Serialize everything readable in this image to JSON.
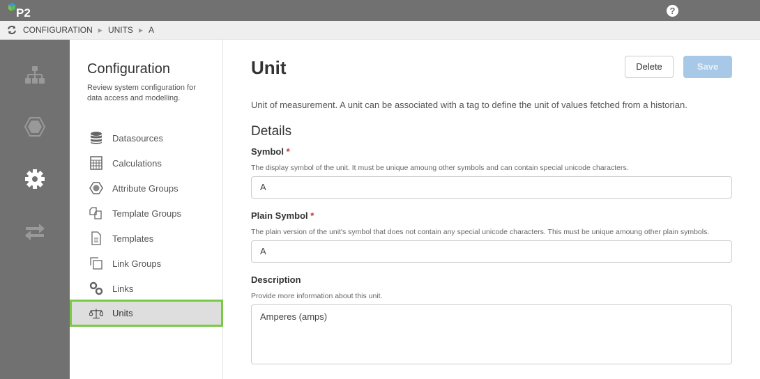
{
  "header": {
    "logo_text": "P2",
    "help_label": "?"
  },
  "breadcrumb": [
    "CONFIGURATION",
    "UNITS",
    "A"
  ],
  "rail": [
    {
      "icon": "sitemap-icon"
    },
    {
      "icon": "hexagon-icon"
    },
    {
      "icon": "gear-icon",
      "active": true
    },
    {
      "icon": "exchange-icon"
    }
  ],
  "nav": {
    "title": "Configuration",
    "subtitle": "Review system configuration for data access and modelling.",
    "items": [
      {
        "label": "Datasources"
      },
      {
        "label": "Calculations"
      },
      {
        "label": "Attribute Groups"
      },
      {
        "label": "Template Groups"
      },
      {
        "label": "Templates"
      },
      {
        "label": "Link Groups"
      },
      {
        "label": "Links"
      },
      {
        "label": "Units",
        "active": true
      }
    ]
  },
  "main": {
    "title": "Unit",
    "delete_label": "Delete",
    "save_label": "Save",
    "description": "Unit of measurement. A unit can be associated with a tag to define the unit of values fetched from a historian.",
    "details_heading": "Details",
    "symbol": {
      "label": "Symbol",
      "required": "*",
      "help": "The display symbol of the unit. It must be unique amoung other symbols and can contain special unicode characters.",
      "value": "A"
    },
    "plain_symbol": {
      "label": "Plain Symbol",
      "required": "*",
      "help": "The plain version of the unit's symbol that does not contain any special unicode characters. This must be unique amoung other plain symbols.",
      "value": "A"
    },
    "description_field": {
      "label": "Description",
      "help": "Provide more information about this unit.",
      "value": "Amperes (amps)"
    }
  },
  "colors": {
    "accent": "#7ac943",
    "save": "#a7c8e6",
    "topbar": "#717171"
  }
}
